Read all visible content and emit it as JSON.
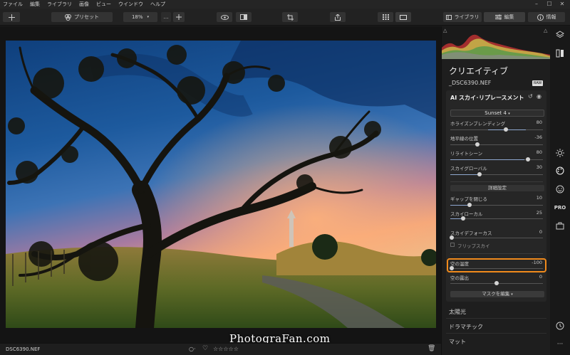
{
  "menu": [
    "ファイル",
    "編集",
    "ライブラリ",
    "画像",
    "ビュー",
    "ウインドウ",
    "ヘルプ"
  ],
  "toolbar": {
    "presets_label": "プリセット",
    "zoom_value": "18%",
    "library_tab": "ライブラリ",
    "edit_tab": "編集",
    "info_tab": "情報"
  },
  "panel": {
    "title": "クリエイティブ",
    "filename": "_DSC6390.NEF",
    "raw_badge": "RAW",
    "module_title": "AI スカイ･リプレースメント",
    "sky_select": "Sunset 4",
    "sliders_top": [
      {
        "label": "ホライズンブレンディング",
        "value": "80",
        "level": 0.87
      },
      {
        "label": "地平線の位置",
        "value": "-36",
        "level": 0.29
      },
      {
        "label": "リライトシーン",
        "value": "80",
        "level": 0.87
      },
      {
        "label": "スカイグローバル",
        "value": "30",
        "level": 0.31
      }
    ],
    "advanced_label": "詳細設定",
    "sliders_adv": [
      {
        "label": "ギャップを閉じる",
        "value": "10",
        "level": 0.21
      },
      {
        "label": "スカイローカル",
        "value": "25",
        "level": 0.14
      },
      {
        "label": "スカイデフォーカス",
        "value": "0",
        "level": 0.0
      }
    ],
    "flip_sky_label": "フリップスカイ",
    "sliders_bottom": [
      {
        "label": "空の温度",
        "value": "-100",
        "level": 0.0
      },
      {
        "label": "空の露出",
        "value": "0",
        "level": 0.5
      }
    ],
    "mask_button": "マスクを編集",
    "other_sections": [
      "太陽光",
      "ドラマチック",
      "マット"
    ]
  },
  "bottom": {
    "filename": "DSC6390.NEF",
    "rating": "☆☆☆☆☆"
  },
  "watermark": "PhotograFan.com",
  "colors": {
    "accent_highlight": "#f08a1c",
    "panel_bg": "#1e1e1e",
    "app_bg": "#141414"
  }
}
